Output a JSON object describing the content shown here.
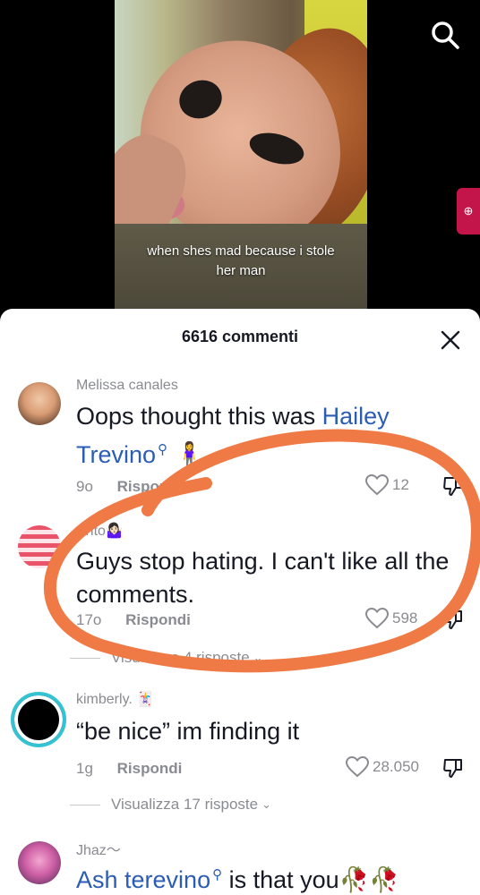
{
  "video": {
    "caption": "when shes mad because i stole her man"
  },
  "comments_sheet": {
    "title": "6616 commenti",
    "comments": [
      {
        "username": "Melissa canales",
        "text_prefix": "Oops thought this was ",
        "mention": "Hailey Trevino",
        "text_suffix": " 🧍‍♀️",
        "time": "9o",
        "reply_label": "Rispondi",
        "likes": "12"
      },
      {
        "username": "Anto🤷🏻‍♀️",
        "text": "Guys stop hating. I can't like all the comments.",
        "time": "17o",
        "reply_label": "Rispondi",
        "likes": "598",
        "view_replies": "Visualizza 4 risposte"
      },
      {
        "username": "kimberly. 🃏",
        "text": "“be nice” im finding it",
        "time": "1g",
        "reply_label": "Rispondi",
        "likes": "28.050",
        "view_replies": "Visualizza 17 risposte"
      },
      {
        "username": "Jhaz〜",
        "mention": "Ash terevino",
        "text_suffix": " is that you🥀🥀"
      }
    ]
  },
  "colors": {
    "mention": "#2b5db4",
    "annotation_stroke": "#f07a45",
    "side_tab": "#c4154a"
  },
  "icons": {
    "search": "search-icon",
    "close": "close-icon",
    "like": "heart-outline-icon",
    "dislike": "thumbs-down-icon"
  }
}
